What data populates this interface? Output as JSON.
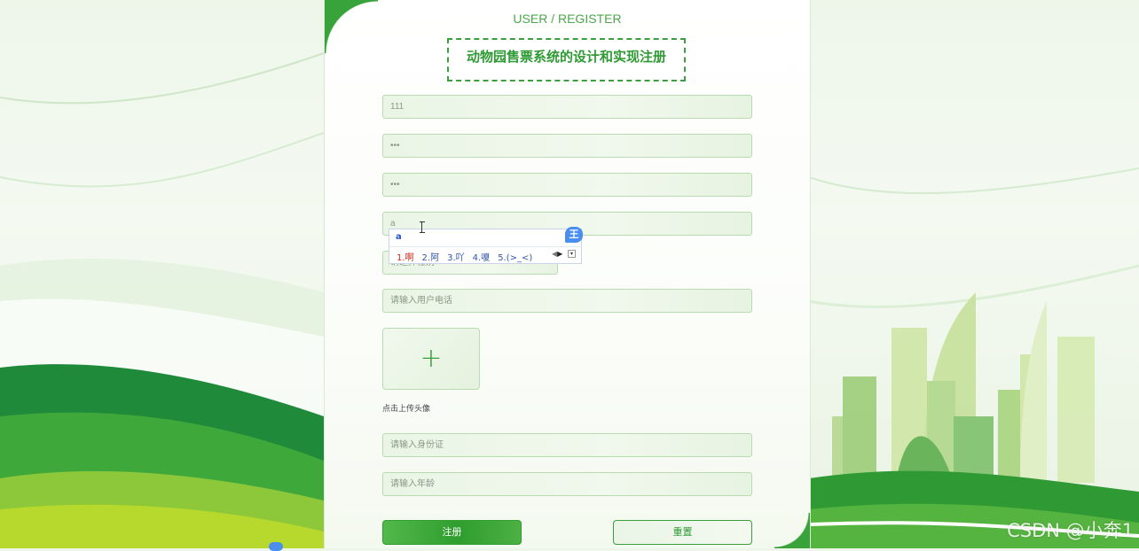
{
  "header": {
    "subtitle": "USER / REGISTER",
    "title": "动物园售票系统的设计和实现注册"
  },
  "form": {
    "account_value": "111",
    "password_value": "•••",
    "confirm_value": "•••",
    "name_value": "a",
    "gender_placeholder": "请选择性别",
    "phone_placeholder": "请输入用户电话",
    "upload_label": "点击上传头像",
    "upload_icon": "plus-icon",
    "idcard_placeholder": "请输入身份证",
    "age_placeholder": "请输入年龄",
    "register_label": "注册",
    "reset_label": "重置"
  },
  "ime": {
    "input": "a",
    "logo": "王",
    "candidates": [
      "1.啊",
      "2.阿",
      "3.吖",
      "4.嗄",
      "5.(>_<)"
    ]
  },
  "watermark": "CSDN @小奔1",
  "colors": {
    "accent": "#37a33a",
    "field_border": "#b9dbb0",
    "ime_blue": "#4a8ef0"
  }
}
